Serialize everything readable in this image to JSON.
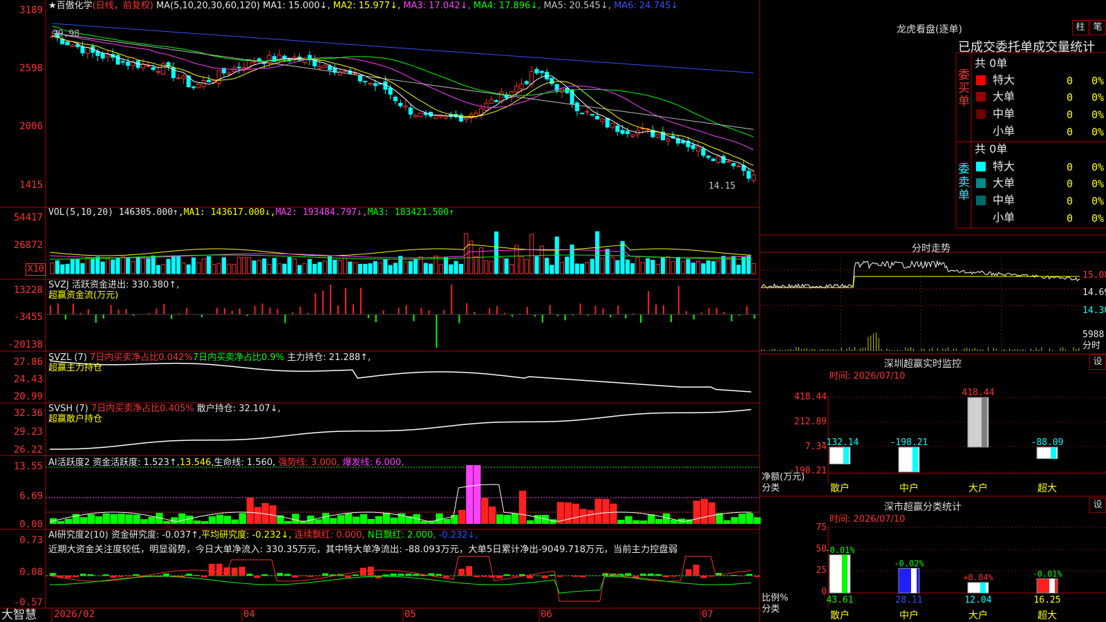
{
  "app": {
    "brand": "大智慧"
  },
  "chart_header": {
    "stock_name": "★百傲化学",
    "period": "(日线，前复权)",
    "ma_params": "MA(5,10,20,30,60,120)",
    "ma1": "MA1: 15.000↓,",
    "ma2": "MA2: 15.977↓,",
    "ma3": "MA3: 17.042↓,",
    "ma4": "MA4: 17.896↓,",
    "ma5": "MA5: 20.545↓,",
    "ma6": "MA6: 24.745↓",
    "colors": {
      "ma1": "#ffffff",
      "ma2": "#ffff00",
      "ma3": "#ff40ff",
      "ma4": "#00ff00",
      "ma5": "#c0c0c0",
      "ma6": "#3050ff"
    }
  },
  "price_axis": [
    "3189",
    "2598",
    "2006",
    "1415"
  ],
  "price_annotations": {
    "high": "29.98",
    "last": "14.15"
  },
  "vol_panel": {
    "axis": [
      "54417",
      "26872",
      "X10"
    ],
    "header": {
      "name": "VOL(5,10,20)",
      "v": "146305.000↑,",
      "ma1": "MA1: 143617.000↓,",
      "ma2": "MA2: 193484.797↓,",
      "ma3": "MA3: 183421.500↑"
    }
  },
  "svzj_panel": {
    "axis": [
      "13228",
      "-3455",
      "-20138"
    ],
    "line1": "SVZJ  活跃资金进出: 330.380↑,",
    "line2": "超赢资金流(万元)"
  },
  "svzl_panel": {
    "axis": [
      "27.86",
      "24.43",
      "20.99"
    ],
    "name": "SVZL (7)",
    "p1": "7日内买卖净占比0.042%",
    "p2": "7日内买卖净占比0.9%",
    "p3": "主力持仓: 21.288↑,",
    "line2": "超赢主力持仓"
  },
  "svsh_panel": {
    "axis": [
      "32.36",
      "29.23",
      "26.22"
    ],
    "name": "SVSH (7)",
    "p1": "7日内买卖净占比0.405%",
    "p2": "散户持仓: 32.107↓,",
    "line2": "超赢散户持仓"
  },
  "ai_active_panel": {
    "axis": [
      "13.55",
      "6.69",
      "0.00"
    ],
    "name": "AI活跃度2",
    "p1": "资金活跃度: 1.523↑,",
    "p2": "13.546,",
    "p3": "生命线: 1.560,",
    "p4": "强势线: 3.000,",
    "p5": "爆发线: 6.000,"
  },
  "ai_research_panel": {
    "axis": [
      "0.73",
      "0.08",
      "-0.57"
    ],
    "name": "AI研究度2(10)",
    "p1": "资金研究度: -0.037↑,",
    "p2": "平均研究度: -0.232↓,",
    "p3": "连续飘红: 0.000,",
    "p4": "N日飘红: 2.000,",
    "p5": "-0.232↓,",
    "comment": "近期大资金关注度较低，明显弱势，今日大单净流入: 330.35万元，其中特大单净流出: -88.093万元，大单5日累计净出-9049.718万元，当前主力控盘弱"
  },
  "date_axis": [
    "2026/02",
    "04",
    "05",
    "06",
    "07"
  ],
  "longhu": {
    "title": "龙虎看盘(逐单)",
    "btn_bar": "柱",
    "btn_line": "笔",
    "subtitle": "已成交委托单成交量统计",
    "buy": {
      "label": "委买单",
      "total": "共 0单",
      "rows": [
        {
          "name": "特大",
          "v": "0",
          "p": "0%"
        },
        {
          "name": "大单",
          "v": "0",
          "p": "0%"
        },
        {
          "name": "中单",
          "v": "0",
          "p": "0%"
        },
        {
          "name": "小单",
          "v": "0",
          "p": "0%"
        }
      ]
    },
    "sell": {
      "label": "委卖单",
      "total": "共 0单",
      "rows": [
        {
          "name": "特大",
          "v": "0",
          "p": "0%"
        },
        {
          "name": "大单",
          "v": "0",
          "p": "0%"
        },
        {
          "name": "中单",
          "v": "0",
          "p": "0%"
        },
        {
          "name": "小单",
          "v": "0",
          "p": "0%"
        }
      ]
    }
  },
  "intraday": {
    "title": "分时走势",
    "axis": [
      "15.08",
      "14.69",
      "14.30",
      "5988",
      "分时"
    ]
  },
  "sz_monitor": {
    "title": "深圳超赢实时监控",
    "btn": "设",
    "time": "时间: 2026/07/10",
    "axis": [
      "418.44",
      "212.89",
      "7.34",
      "-198.21"
    ],
    "ylabel": "净额(万元)",
    "xlabel": "分类",
    "bars": [
      {
        "cat": "散户",
        "value": -132.14,
        "label": "-132.14"
      },
      {
        "cat": "中户",
        "value": -198.21,
        "label": "-198.21"
      },
      {
        "cat": "大户",
        "value": 418.44,
        "label": "418.44"
      },
      {
        "cat": "超大",
        "value": -88.09,
        "label": "-88.09"
      }
    ]
  },
  "sz_stats": {
    "title": "深市超赢分类统计",
    "btn": "设",
    "time": "时间: 2026/07/10",
    "axis": [
      "75",
      "50",
      "25",
      "0"
    ],
    "ylabel": "比例%",
    "xlabel": "分类",
    "bars": [
      {
        "cat": "散户",
        "value": 43.61,
        "label": "43.61",
        "chg": "-0.01%"
      },
      {
        "cat": "中户",
        "value": 28.11,
        "label": "28.11",
        "chg": "-0.02%"
      },
      {
        "cat": "大户",
        "value": 12.04,
        "label": "12.04",
        "chg": "+0.04%"
      },
      {
        "cat": "超大",
        "value": 16.25,
        "label": "16.25",
        "chg": "-0.01%"
      }
    ]
  }
}
